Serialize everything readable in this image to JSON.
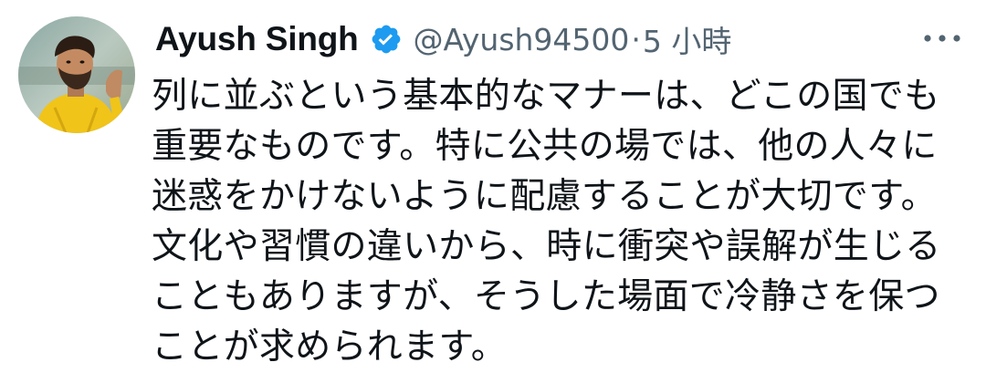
{
  "tweet": {
    "author": {
      "display_name": "Ayush Singh",
      "handle": "@Ayush94500",
      "verified": true,
      "avatar_icon": "user-avatar-photo"
    },
    "separator": "·",
    "timestamp": "5 小時",
    "more_icon": "more-horizontal-icon",
    "text": "列に並ぶという基本的なマナーは、どこの国でも重要なものです。特に公共の場では、他の人々に迷惑をかけないように配慮することが大切です。文化や習慣の違いから、時に衝突や誤解が生じることもありますが、そうした場面で冷静さを保つことが求められます。"
  },
  "colors": {
    "text_primary": "#0f1419",
    "text_secondary": "#536471",
    "verified_blue": "#1d9bf0",
    "background": "#ffffff"
  }
}
